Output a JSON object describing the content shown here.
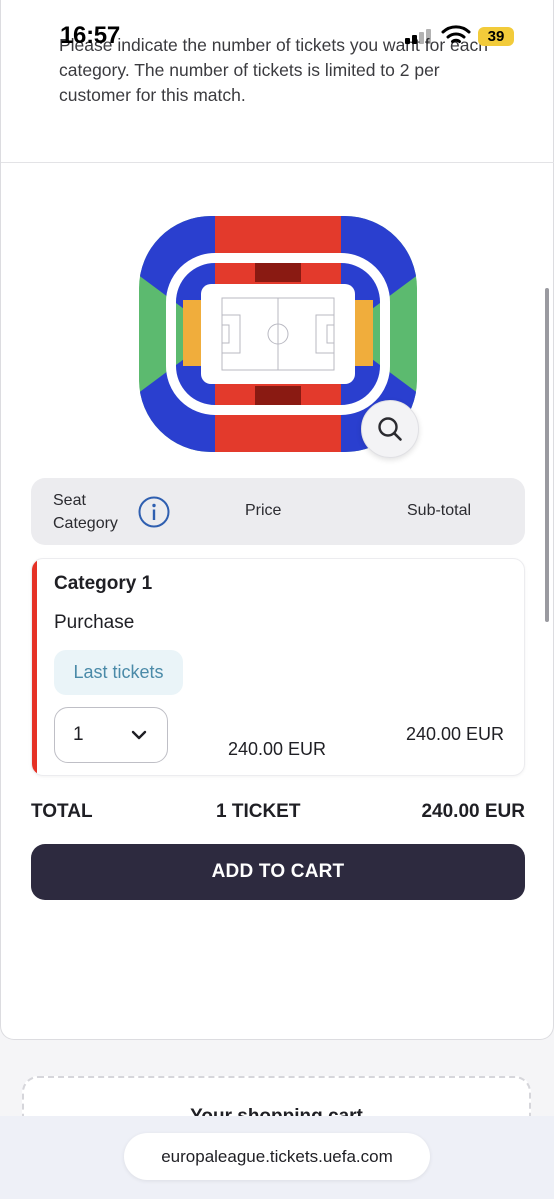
{
  "status_bar": {
    "time": "16:57",
    "battery": "39"
  },
  "intro_text": "Please indicate the number of tickets you want for each category. The number of tickets is limited to 2 per customer for this match.",
  "table_header": {
    "seat_category": "Seat Category",
    "price": "Price",
    "subtotal": "Sub-total"
  },
  "category": {
    "title": "Category 1",
    "type": "Purchase",
    "badge": "Last tickets",
    "quantity": "1",
    "price": "240.00 EUR",
    "subtotal": "240.00 EUR",
    "accent_color": "#e53125"
  },
  "total": {
    "label": "TOTAL",
    "count": "1 TICKET",
    "amount": "240.00 EUR"
  },
  "add_to_cart_label": "ADD TO CART",
  "cart": {
    "title": "Your shopping cart"
  },
  "browser": {
    "url": "europaleague.tickets.uefa.com"
  },
  "icons": [
    "signal-icon",
    "wifi-icon",
    "battery-icon",
    "zoom-icon",
    "info-icon",
    "chevron-down-icon"
  ],
  "colors": {
    "primary_button": "#2d2a3f",
    "category_red": "#e53125",
    "stadium_blue": "#2a3fcf",
    "stadium_green": "#5cba6f",
    "stadium_orange": "#f0ad3c",
    "stadium_darkred": "#8a1a12"
  }
}
